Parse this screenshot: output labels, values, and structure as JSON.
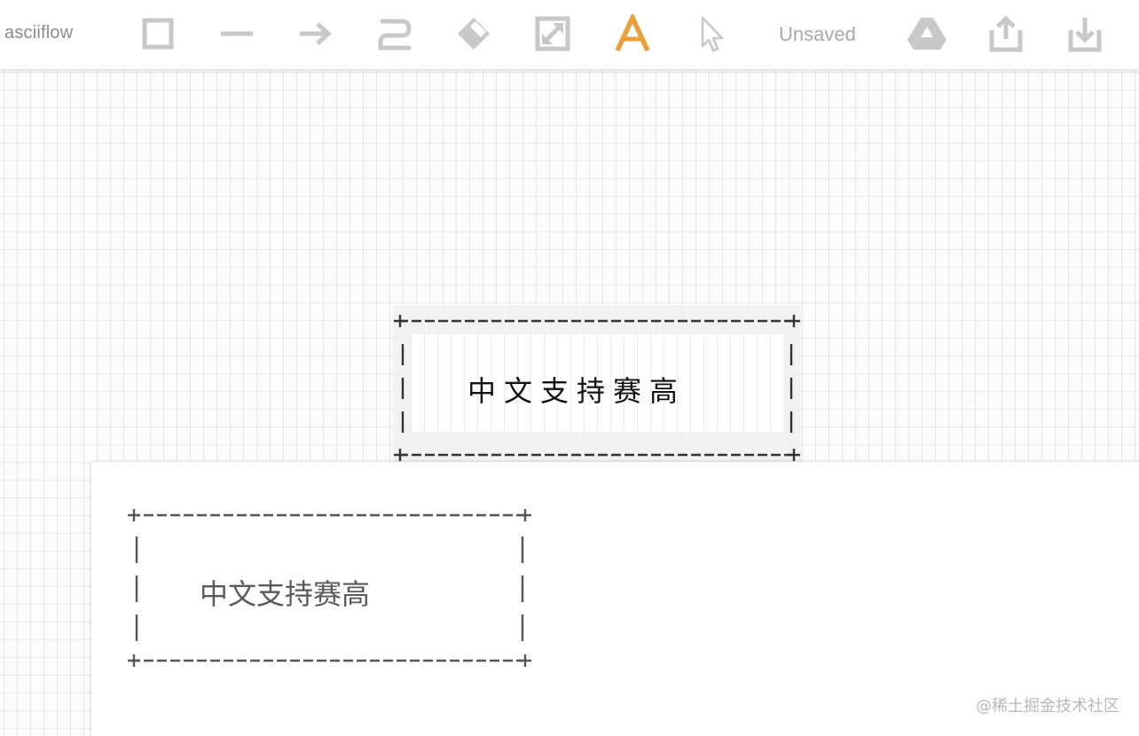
{
  "app": {
    "name": "asciiflow",
    "status": "Unsaved"
  },
  "toolbar": {
    "tools": [
      {
        "id": "box",
        "icon": "box-icon"
      },
      {
        "id": "line",
        "icon": "line-icon"
      },
      {
        "id": "arrow",
        "icon": "arrow-icon"
      },
      {
        "id": "freeform",
        "icon": "freeform-icon"
      },
      {
        "id": "erase",
        "icon": "eraser-icon"
      },
      {
        "id": "resize",
        "icon": "resize-icon"
      },
      {
        "id": "text",
        "icon": "text-icon",
        "active": true
      },
      {
        "id": "select",
        "icon": "cursor-icon"
      }
    ],
    "actions": [
      {
        "id": "drive",
        "icon": "google-drive-icon"
      },
      {
        "id": "export",
        "icon": "share-icon"
      },
      {
        "id": "import",
        "icon": "download-icon"
      }
    ],
    "colors": {
      "active": "#e9a03b",
      "inactive": "#c8c8c8"
    }
  },
  "canvas": {
    "box_text": "中文支持赛高"
  },
  "preview": {
    "text": "中文支持赛高"
  },
  "watermark": "@稀土掘金技术社区"
}
